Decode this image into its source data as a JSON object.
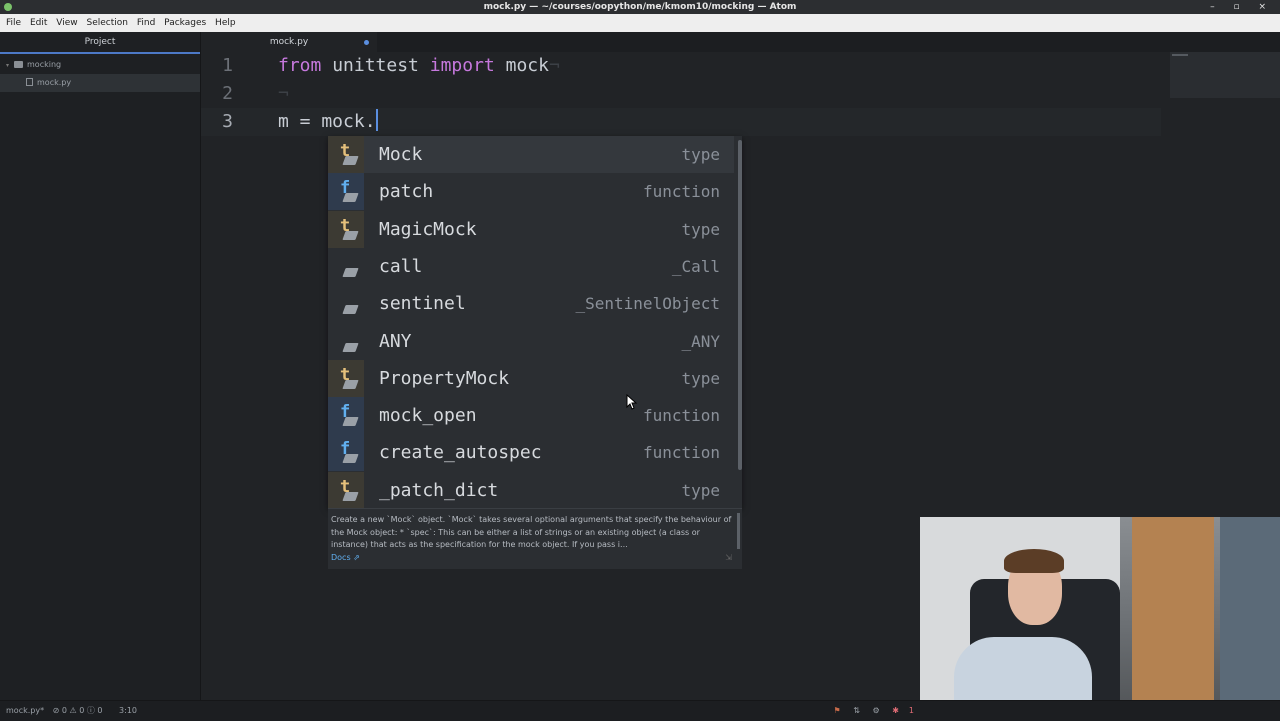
{
  "window": {
    "title": "mock.py — ~/courses/oopython/me/kmom10/mocking — Atom",
    "controls": "– ▫ ×"
  },
  "menu": [
    "File",
    "Edit",
    "View",
    "Selection",
    "Find",
    "Packages",
    "Help"
  ],
  "sidebar": {
    "title": "Project",
    "folder": "mocking",
    "file": "mock.py"
  },
  "tab": {
    "label": "mock.py",
    "modified": true
  },
  "editor": {
    "lines": [
      {
        "number": "1",
        "keyword1": "from",
        "mid": " unittest ",
        "keyword2": "import",
        "rest": " mock",
        "eol": "¬"
      },
      {
        "number": "2",
        "text": "¬"
      },
      {
        "number": "3",
        "text": "m = mock."
      }
    ]
  },
  "autocomplete": {
    "items": [
      {
        "icon": "t",
        "kind": "type",
        "label": "Mock",
        "type": "type",
        "selected": true
      },
      {
        "icon": "f",
        "kind": "function",
        "label": "patch",
        "type": "function"
      },
      {
        "icon": "t",
        "kind": "type",
        "label": "MagicMock",
        "type": "type"
      },
      {
        "icon": "",
        "kind": "other",
        "label": "call",
        "type": "_Call"
      },
      {
        "icon": "",
        "kind": "other",
        "label": "sentinel",
        "type": "_SentinelObject"
      },
      {
        "icon": "",
        "kind": "other",
        "label": "ANY",
        "type": "_ANY"
      },
      {
        "icon": "t",
        "kind": "type",
        "label": "PropertyMock",
        "type": "type"
      },
      {
        "icon": "f",
        "kind": "function",
        "label": "mock_open",
        "type": "function"
      },
      {
        "icon": "f",
        "kind": "function",
        "label": "create_autospec",
        "type": "function"
      },
      {
        "icon": "t",
        "kind": "type",
        "label": "_patch_dict",
        "type": "type"
      }
    ],
    "description": "Create a new `Mock` object. `Mock` takes several optional arguments that specify the behaviour of the Mock object: * `spec`: This can be either a list of strings or an existing object (a class or instance) that acts as the specification for the mock object. If you pass i...",
    "docs_link": "Docs ⇗",
    "corner": "⇲"
  },
  "statusbar": {
    "file": "mock.py*",
    "diagnostics": "⊘ 0 ⚠ 0 ⓘ 0",
    "cursor_position": "3:10",
    "right_count": "1"
  },
  "colors": {
    "accent": "#5b8fe0",
    "keyword": "#c678dd",
    "type_icon": "#e5c07b",
    "function_icon": "#61afef"
  }
}
